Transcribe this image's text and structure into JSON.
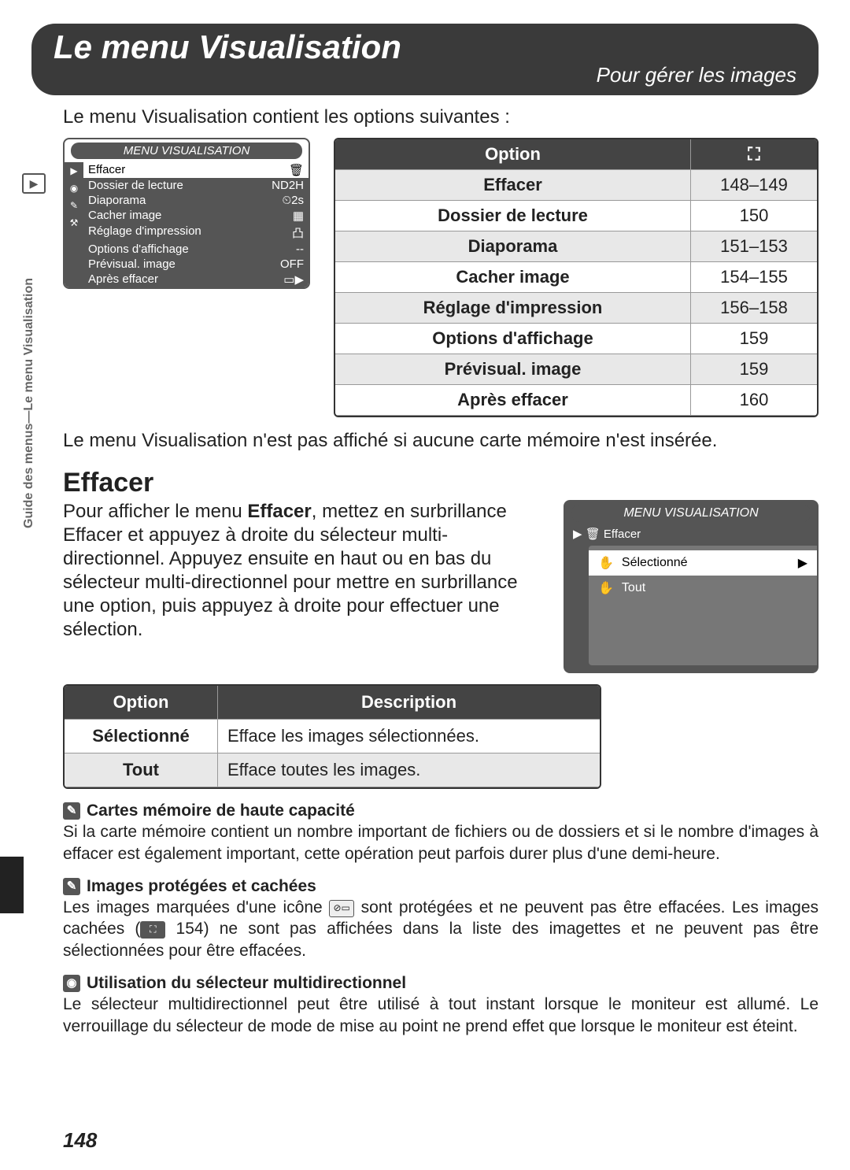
{
  "header": {
    "title": "Le menu Visualisation",
    "subtitle": "Pour gérer les images"
  },
  "intro": "Le menu Visualisation contient les options suivantes :",
  "sideLabel": "Guide des menus—Le menu Visualisation",
  "screenshot1": {
    "title": "MENU VISUALISATION",
    "items": [
      {
        "label": "Effacer",
        "value": "🗑"
      },
      {
        "label": "Dossier de lecture",
        "value": "ND2H"
      },
      {
        "label": "Diaporama",
        "value": "⏲2s"
      },
      {
        "label": "Cacher image",
        "value": "▦"
      },
      {
        "label": "Réglage d'impression",
        "value": "凸"
      },
      {
        "label": "Options d'affichage",
        "value": "--"
      },
      {
        "label": "Prévisual. image",
        "value": "OFF"
      },
      {
        "label": "Après effacer",
        "value": "▭▶"
      }
    ]
  },
  "optionsTable": {
    "headers": {
      "option": "Option",
      "pageIcon": "⛶"
    },
    "rows": [
      {
        "label": "Effacer",
        "pages": "148–149"
      },
      {
        "label": "Dossier de lecture",
        "pages": "150"
      },
      {
        "label": "Diaporama",
        "pages": "151–153"
      },
      {
        "label": "Cacher image",
        "pages": "154–155"
      },
      {
        "label": "Réglage d'impression",
        "pages": "156–158"
      },
      {
        "label": "Options d'affichage",
        "pages": "159"
      },
      {
        "label": "Prévisual. image",
        "pages": "159"
      },
      {
        "label": "Après effacer",
        "pages": "160"
      }
    ]
  },
  "noCardNote": "Le menu Visualisation n'est pas affiché si aucune carte mémoire n'est insérée.",
  "section": {
    "heading": "Effacer",
    "body_a": "Pour afficher le menu ",
    "body_bold": "Effacer",
    "body_b": ", mettez en surbrillance Effacer et appuyez à droite du sélecteur multi-directionnel. Appuyez ensuite en haut ou en bas du sélecteur multi-directionnel pour mettre en surbrillance une option, puis appuyez à droite pour effectuer une sélection."
  },
  "screenshot2": {
    "title": "MENU VISUALISATION",
    "crumb": "🗑 Effacer",
    "options": {
      "selected": "Sélectionné",
      "all": "Tout"
    }
  },
  "descTable": {
    "headers": {
      "opt": "Option",
      "desc": "Description"
    },
    "rows": [
      {
        "opt": "Sélectionné",
        "desc": "Efface les images sélectionnées."
      },
      {
        "opt": "Tout",
        "desc": "Efface toutes les images."
      }
    ]
  },
  "notes": {
    "n1": {
      "title": "Cartes mémoire de haute capacité",
      "body": "Si la carte mémoire contient un nombre important de fichiers ou de dossiers et si le nombre d'images à effacer est également important, cette opération peut parfois durer plus d'une demi-heure."
    },
    "n2": {
      "title": "Images protégées et cachées",
      "body_a": "Les images marquées d'une icône ",
      "body_b": " sont protégées et ne peuvent pas être effacées. Les images cachées (",
      "body_c": " 154) ne sont pas affichées dans la liste des imagettes et ne peuvent pas être sélectionnées pour être effacées."
    },
    "n3": {
      "title": "Utilisation du sélecteur multidirectionnel",
      "body": "Le sélecteur multidirectionnel peut être utilisé à tout instant lorsque le moniteur est allumé. Le verrouillage du sélecteur de mode de mise au point ne prend effet que lorsque le moniteur est éteint."
    }
  },
  "pageNumber": "148"
}
